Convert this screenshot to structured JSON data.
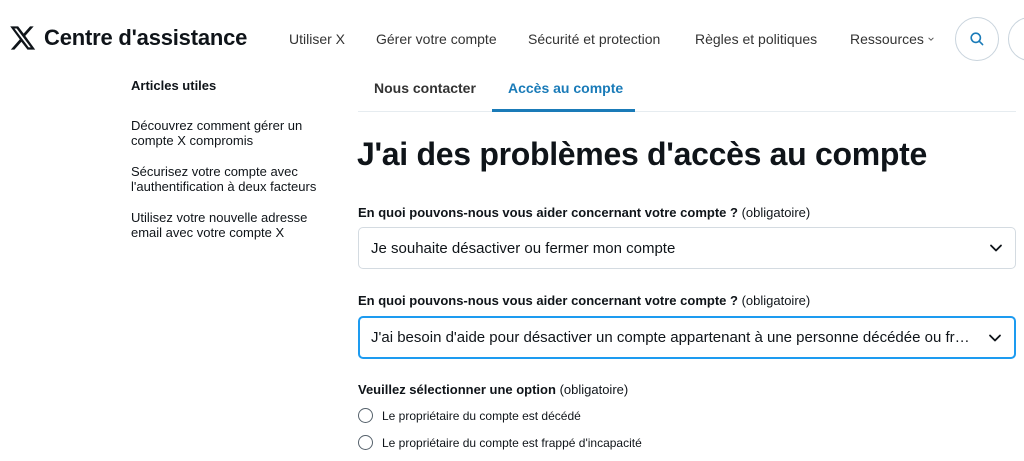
{
  "header": {
    "brand": "Centre d'assistance",
    "nav": [
      {
        "label": "Utiliser X"
      },
      {
        "label": "Gérer votre compte"
      },
      {
        "label": "Sécurité et protection"
      },
      {
        "label": "Règles et politiques"
      },
      {
        "label": "Ressources"
      }
    ],
    "icons": [
      "x-logo-icon",
      "search-icon",
      "chevron-down-icon"
    ]
  },
  "sidebar": {
    "title": "Articles utiles",
    "links": [
      {
        "label": "Découvrez comment gérer un compte X compromis"
      },
      {
        "label": "Sécurisez votre compte avec l'authentification à deux facteurs"
      },
      {
        "label": "Utilisez votre nouvelle adresse email avec votre compte X"
      }
    ]
  },
  "tabs": [
    {
      "label": "Nous contacter",
      "active": false
    },
    {
      "label": "Accès au compte",
      "active": true
    }
  ],
  "main": {
    "title": "J'ai des problèmes d'accès au compte",
    "field1": {
      "question": "En quoi pouvons-nous vous aider concernant votre compte ?",
      "required": "(obligatoire)",
      "value": "Je souhaite désactiver ou fermer mon compte"
    },
    "field2": {
      "question": "En quoi pouvons-nous vous aider concernant votre compte ?",
      "required": "(obligatoire)",
      "value": "J'ai besoin d'aide pour désactiver un compte appartenant à une personne décédée ou frappée d'incapacité"
    },
    "options": {
      "heading": "Veuillez sélectionner une option",
      "required": "(obligatoire)",
      "items": [
        {
          "label": "Le propriétaire du compte est décédé"
        },
        {
          "label": "Le propriétaire du compte est frappé d'incapacité"
        }
      ]
    }
  },
  "colors": {
    "accent": "#1a7bb8",
    "focus": "#1d9bf0",
    "text": "#0f1419",
    "border": "#d4dbe1"
  }
}
